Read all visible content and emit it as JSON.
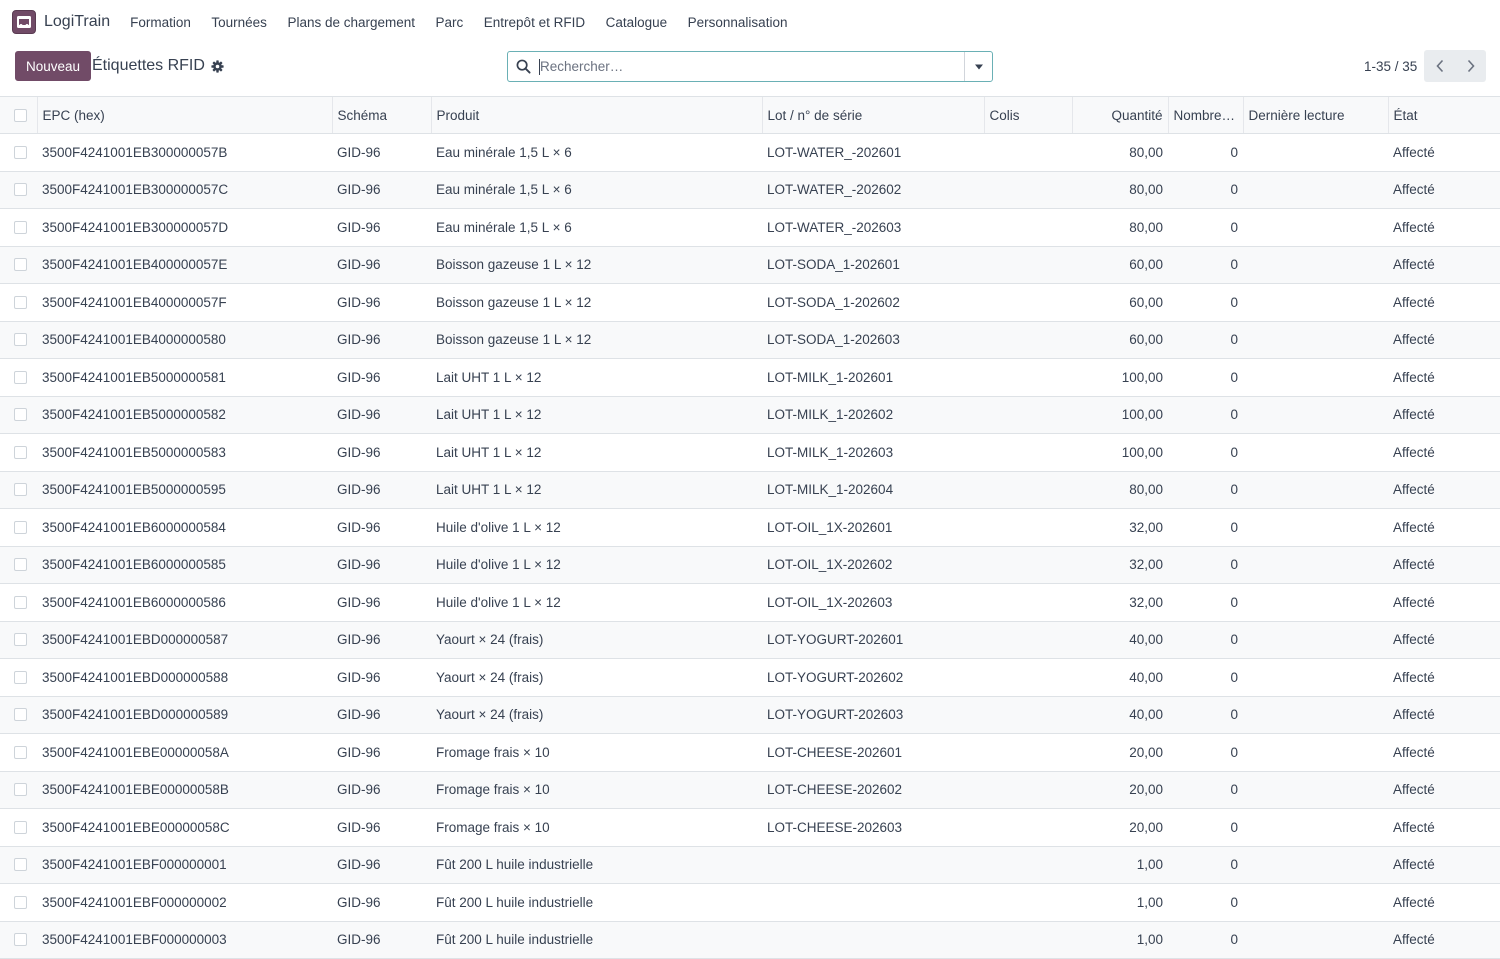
{
  "app": {
    "name": "LogiTrain"
  },
  "menu": [
    "Formation",
    "Tournées",
    "Plans de chargement",
    "Parc",
    "Entrepôt et RFID",
    "Catalogue",
    "Personnalisation"
  ],
  "control": {
    "new_label": "Nouveau",
    "title": "Étiquettes RFID",
    "search_placeholder": "Rechercher…",
    "pager": "1-35 / 35"
  },
  "columns": [
    "EPC (hex)",
    "Schéma",
    "Produit",
    "Lot / n° de série",
    "Colis",
    "Quantité",
    "Nombre …",
    "Dernière lecture",
    "État"
  ],
  "rows": [
    {
      "epc": "3500F4241001EB300000057B",
      "scheme": "GID-96",
      "product": "Eau minérale 1,5 L × 6",
      "lot": "LOT-WATER_-202601",
      "package": "",
      "qty": "80,00",
      "count": "0",
      "last_read": "",
      "state": "Affecté"
    },
    {
      "epc": "3500F4241001EB300000057C",
      "scheme": "GID-96",
      "product": "Eau minérale 1,5 L × 6",
      "lot": "LOT-WATER_-202602",
      "package": "",
      "qty": "80,00",
      "count": "0",
      "last_read": "",
      "state": "Affecté"
    },
    {
      "epc": "3500F4241001EB300000057D",
      "scheme": "GID-96",
      "product": "Eau minérale 1,5 L × 6",
      "lot": "LOT-WATER_-202603",
      "package": "",
      "qty": "80,00",
      "count": "0",
      "last_read": "",
      "state": "Affecté"
    },
    {
      "epc": "3500F4241001EB400000057E",
      "scheme": "GID-96",
      "product": "Boisson gazeuse 1 L × 12",
      "lot": "LOT-SODA_1-202601",
      "package": "",
      "qty": "60,00",
      "count": "0",
      "last_read": "",
      "state": "Affecté"
    },
    {
      "epc": "3500F4241001EB400000057F",
      "scheme": "GID-96",
      "product": "Boisson gazeuse 1 L × 12",
      "lot": "LOT-SODA_1-202602",
      "package": "",
      "qty": "60,00",
      "count": "0",
      "last_read": "",
      "state": "Affecté"
    },
    {
      "epc": "3500F4241001EB4000000580",
      "scheme": "GID-96",
      "product": "Boisson gazeuse 1 L × 12",
      "lot": "LOT-SODA_1-202603",
      "package": "",
      "qty": "60,00",
      "count": "0",
      "last_read": "",
      "state": "Affecté"
    },
    {
      "epc": "3500F4241001EB5000000581",
      "scheme": "GID-96",
      "product": "Lait UHT 1 L × 12",
      "lot": "LOT-MILK_1-202601",
      "package": "",
      "qty": "100,00",
      "count": "0",
      "last_read": "",
      "state": "Affecté"
    },
    {
      "epc": "3500F4241001EB5000000582",
      "scheme": "GID-96",
      "product": "Lait UHT 1 L × 12",
      "lot": "LOT-MILK_1-202602",
      "package": "",
      "qty": "100,00",
      "count": "0",
      "last_read": "",
      "state": "Affecté"
    },
    {
      "epc": "3500F4241001EB5000000583",
      "scheme": "GID-96",
      "product": "Lait UHT 1 L × 12",
      "lot": "LOT-MILK_1-202603",
      "package": "",
      "qty": "100,00",
      "count": "0",
      "last_read": "",
      "state": "Affecté"
    },
    {
      "epc": "3500F4241001EB5000000595",
      "scheme": "GID-96",
      "product": "Lait UHT 1 L × 12",
      "lot": "LOT-MILK_1-202604",
      "package": "",
      "qty": "80,00",
      "count": "0",
      "last_read": "",
      "state": "Affecté"
    },
    {
      "epc": "3500F4241001EB6000000584",
      "scheme": "GID-96",
      "product": "Huile d'olive 1 L × 12",
      "lot": "LOT-OIL_1X-202601",
      "package": "",
      "qty": "32,00",
      "count": "0",
      "last_read": "",
      "state": "Affecté"
    },
    {
      "epc": "3500F4241001EB6000000585",
      "scheme": "GID-96",
      "product": "Huile d'olive 1 L × 12",
      "lot": "LOT-OIL_1X-202602",
      "package": "",
      "qty": "32,00",
      "count": "0",
      "last_read": "",
      "state": "Affecté"
    },
    {
      "epc": "3500F4241001EB6000000586",
      "scheme": "GID-96",
      "product": "Huile d'olive 1 L × 12",
      "lot": "LOT-OIL_1X-202603",
      "package": "",
      "qty": "32,00",
      "count": "0",
      "last_read": "",
      "state": "Affecté"
    },
    {
      "epc": "3500F4241001EBD000000587",
      "scheme": "GID-96",
      "product": "Yaourt × 24 (frais)",
      "lot": "LOT-YOGURT-202601",
      "package": "",
      "qty": "40,00",
      "count": "0",
      "last_read": "",
      "state": "Affecté"
    },
    {
      "epc": "3500F4241001EBD000000588",
      "scheme": "GID-96",
      "product": "Yaourt × 24 (frais)",
      "lot": "LOT-YOGURT-202602",
      "package": "",
      "qty": "40,00",
      "count": "0",
      "last_read": "",
      "state": "Affecté"
    },
    {
      "epc": "3500F4241001EBD000000589",
      "scheme": "GID-96",
      "product": "Yaourt × 24 (frais)",
      "lot": "LOT-YOGURT-202603",
      "package": "",
      "qty": "40,00",
      "count": "0",
      "last_read": "",
      "state": "Affecté"
    },
    {
      "epc": "3500F4241001EBE00000058A",
      "scheme": "GID-96",
      "product": "Fromage frais × 10",
      "lot": "LOT-CHEESE-202601",
      "package": "",
      "qty": "20,00",
      "count": "0",
      "last_read": "",
      "state": "Affecté"
    },
    {
      "epc": "3500F4241001EBE00000058B",
      "scheme": "GID-96",
      "product": "Fromage frais × 10",
      "lot": "LOT-CHEESE-202602",
      "package": "",
      "qty": "20,00",
      "count": "0",
      "last_read": "",
      "state": "Affecté"
    },
    {
      "epc": "3500F4241001EBE00000058C",
      "scheme": "GID-96",
      "product": "Fromage frais × 10",
      "lot": "LOT-CHEESE-202603",
      "package": "",
      "qty": "20,00",
      "count": "0",
      "last_read": "",
      "state": "Affecté"
    },
    {
      "epc": "3500F4241001EBF000000001",
      "scheme": "GID-96",
      "product": "Fût 200 L huile industrielle",
      "lot": "",
      "package": "",
      "qty": "1,00",
      "count": "0",
      "last_read": "",
      "state": "Affecté"
    },
    {
      "epc": "3500F4241001EBF000000002",
      "scheme": "GID-96",
      "product": "Fût 200 L huile industrielle",
      "lot": "",
      "package": "",
      "qty": "1,00",
      "count": "0",
      "last_read": "",
      "state": "Affecté"
    },
    {
      "epc": "3500F4241001EBF000000003",
      "scheme": "GID-96",
      "product": "Fût 200 L huile industrielle",
      "lot": "",
      "package": "",
      "qty": "1,00",
      "count": "0",
      "last_read": "",
      "state": "Affecté"
    }
  ],
  "colors": {
    "primary": "#714B67",
    "search_border": "#6ab0b5",
    "row_alt": "#f8f9fa"
  },
  "icons": {
    "app": "truck-icon",
    "search": "search-icon",
    "gear": "gear-icon",
    "dropdown": "caret-down-icon",
    "prev": "chevron-left-icon",
    "next": "chevron-right-icon"
  }
}
